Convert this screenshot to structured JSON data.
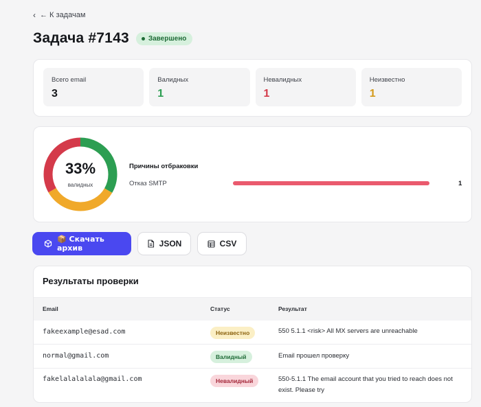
{
  "nav": {
    "back_chevron": "‹",
    "back_label": "← К задачам"
  },
  "header": {
    "title": "Задача #7143",
    "status": "Завершено",
    "status_color": "#1f6b37"
  },
  "stats": [
    {
      "label": "Всего email",
      "value": "3",
      "color": "#15171b"
    },
    {
      "label": "Валидных",
      "value": "1",
      "color": "#2c9e52"
    },
    {
      "label": "Невалидных",
      "value": "1",
      "color": "#d43a4a"
    },
    {
      "label": "Неизвестно",
      "value": "1",
      "color": "#d49a1a"
    }
  ],
  "donut": {
    "percent_text": "33%",
    "sub_label": "валидных",
    "segments": [
      {
        "name": "valid",
        "fraction": 0.3333,
        "color": "#2c9e52"
      },
      {
        "name": "unknown",
        "fraction": 0.3333,
        "color": "#f0a92a"
      },
      {
        "name": "invalid",
        "fraction": 0.3334,
        "color": "#d43a4a"
      }
    ]
  },
  "reasons": {
    "title": "Причины отбраковки",
    "items": [
      {
        "label": "Отказ SMTP",
        "count": "1",
        "fraction": 1.0,
        "color": "#ea5a6e"
      }
    ]
  },
  "actions": {
    "download_label": "📦 Скачать архив",
    "json_label": "JSON",
    "csv_label": "CSV",
    "primary_color": "#4a48f0"
  },
  "results": {
    "title": "Результаты проверки",
    "columns": {
      "email": "Email",
      "status": "Статус",
      "result": "Результат"
    },
    "rows": [
      {
        "email": "fakeexample@esad.com",
        "status": "Неизвестно",
        "status_type": "unknown",
        "result": "550 5.1.1 <risk> All MX servers are unreachable"
      },
      {
        "email": "normal@gmail.com",
        "status": "Валидный",
        "status_type": "valid",
        "result": "Email прошел проверку"
      },
      {
        "email": "fakelalalalala@gmail.com",
        "status": "Невалидный",
        "status_type": "invalid",
        "result": "550-5.1.1 The email account that you tried to reach does not exist. Please try"
      }
    ]
  }
}
